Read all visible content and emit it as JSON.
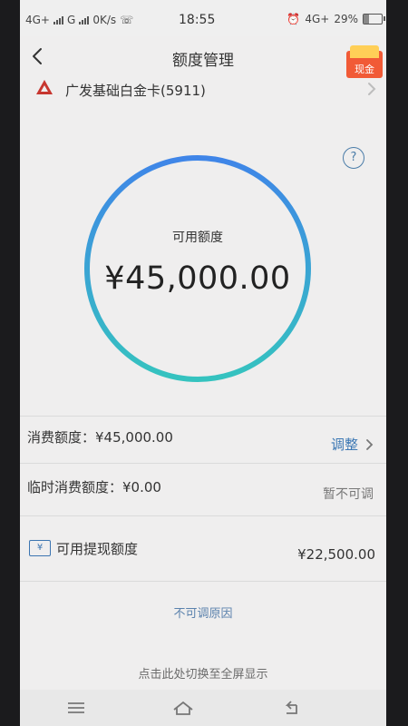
{
  "status_bar": {
    "left_text": "4G+",
    "left_text2": "G",
    "speed": "0K/s",
    "time": "18:55",
    "network": "4G+",
    "battery": "29%"
  },
  "header": {
    "title": "额度管理",
    "cash_badge": "现金"
  },
  "card": {
    "name": "广发基础白金卡(5911)"
  },
  "quota": {
    "label": "可用额度",
    "amount": "¥45,000.00"
  },
  "limits": {
    "spending": "消费额度：¥45,000.00",
    "adjust_label": "调整",
    "temporary": "临时消费额度：¥0.00",
    "temporary_status": "暂不可调"
  },
  "withdraw": {
    "icon_text": "¥",
    "label": "可用提现额度",
    "amount": "¥22,500.00"
  },
  "links": {
    "reason": "不可调原因",
    "fullscreen": "点击此处切换至全屏显示"
  },
  "colors": {
    "ring_blue": "#3f85e8",
    "ring_teal": "#35c3bf",
    "link_blue": "#3d78b4",
    "brand_red": "#c7362f"
  }
}
